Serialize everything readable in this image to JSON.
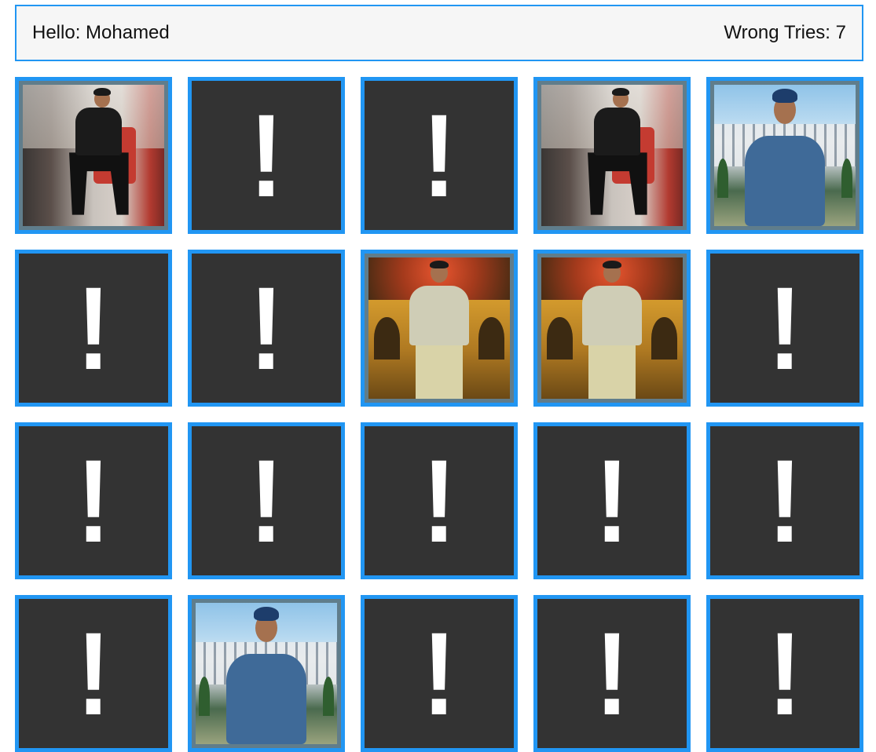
{
  "header": {
    "hello_label": "Hello: Mohamed",
    "tries_label": "Wrong Tries: 7"
  },
  "colors": {
    "card_border": "#2196f3",
    "card_back": "#333333",
    "card_front_frame": "#607d8b",
    "header_bg": "#f6f6f6"
  },
  "back_symbol": "!",
  "board": {
    "columns": 5,
    "cards": [
      {
        "state": "flipped",
        "photo": "photo-indoor-sitting"
      },
      {
        "state": "hidden"
      },
      {
        "state": "hidden"
      },
      {
        "state": "flipped",
        "photo": "photo-indoor-sitting"
      },
      {
        "state": "flipped",
        "photo": "photo-hotel-jacket"
      },
      {
        "state": "hidden"
      },
      {
        "state": "hidden"
      },
      {
        "state": "flipped",
        "photo": "photo-night-building"
      },
      {
        "state": "flipped",
        "photo": "photo-night-building"
      },
      {
        "state": "hidden"
      },
      {
        "state": "hidden"
      },
      {
        "state": "hidden"
      },
      {
        "state": "hidden"
      },
      {
        "state": "hidden"
      },
      {
        "state": "hidden"
      },
      {
        "state": "hidden"
      },
      {
        "state": "flipped",
        "photo": "photo-hotel-jacket"
      },
      {
        "state": "hidden"
      },
      {
        "state": "hidden"
      },
      {
        "state": "hidden"
      }
    ]
  }
}
